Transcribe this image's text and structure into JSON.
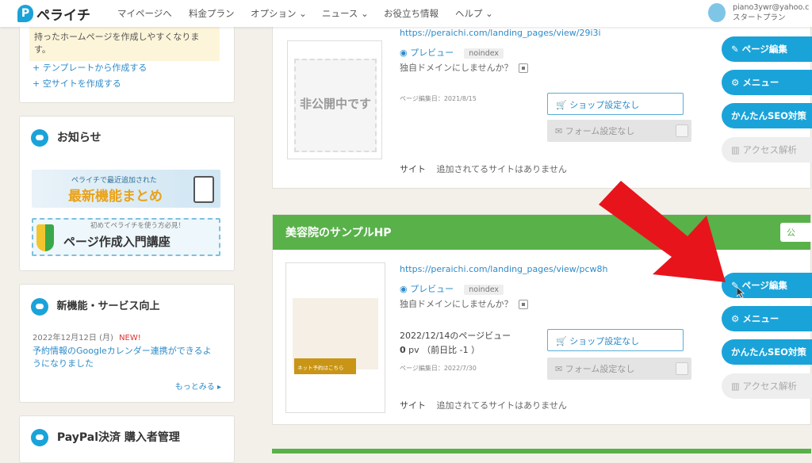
{
  "nav": {
    "logo_letter": "P",
    "logo_text": "ペライチ",
    "items": [
      "マイページへ",
      "料金プラン",
      "オプション ⌄",
      "ニュース ⌄",
      "お役立ち情報",
      "ヘルプ ⌄"
    ],
    "user_email": "piano3ywr@yahoo.c",
    "user_plan": "スタートプラン"
  },
  "sidebar": {
    "intro_text_1": "持ったホームページを作成しやすくなりま",
    "intro_text_2": "す。",
    "link_template": "+ テンプレートから作成する",
    "link_blank": "+ 空サイトを作成する",
    "notice_title": "お知らせ",
    "banner1_small": "ペライチで最近追加された",
    "banner1_big": "最新機能まとめ",
    "banner2_small": "初めてペライチを使う方必見！",
    "banner2_big": "ページ作成入門講座",
    "news_title": "新機能・サービス向上",
    "news_date": "2022年12月12日 (月)",
    "news_new": "NEW!",
    "news_text_1": "予約情報のGoogleカレンダー連携ができるよ",
    "news_text_2": "うになりました",
    "news_more": "もっとみる ▸",
    "paypal_title": "PayPal決済 購入者管理"
  },
  "site1": {
    "url": "https://peraichi.com/landing_pages/view/29i3i",
    "preview": "◉ プレビュー",
    "noindex": "noindex",
    "domain": "独自ドメインにしませんか？",
    "private": "非公開中です",
    "edited": "ページ編集日：2021/8/15",
    "shop": "🛒 ショップ設定なし",
    "form": "✉ フォーム設定なし",
    "site_label": "サイト",
    "site_none": "追加されてるサイトはありません"
  },
  "site2": {
    "title": "美容院のサンプルHP",
    "status": "公",
    "url": "https://peraichi.com/landing_pages/view/pcw8h",
    "preview": "◉ プレビュー",
    "noindex": "noindex",
    "domain": "独自ドメインにしませんか？",
    "views_label": "2022/12/14のページビュー",
    "views_value": "0",
    "views_unit": "pv",
    "views_change": "（前日比 -1 ）",
    "thumb_button": "ネット予約はこちら",
    "edited": "ページ編集日：2022/7/30",
    "shop": "🛒 ショップ設定なし",
    "form": "✉ フォーム設定なし",
    "site_label": "サイト",
    "site_none": "追加されてるサイトはありません"
  },
  "actions": {
    "edit": "✎ ページ編集",
    "menu": "⚙ メニュー",
    "seo": "かんたんSEO対策",
    "analytics": "▥ アクセス解析"
  },
  "colors": {
    "accent": "#1aa3d9",
    "header_green": "#59b14a",
    "arrow_red": "#e8141b"
  }
}
